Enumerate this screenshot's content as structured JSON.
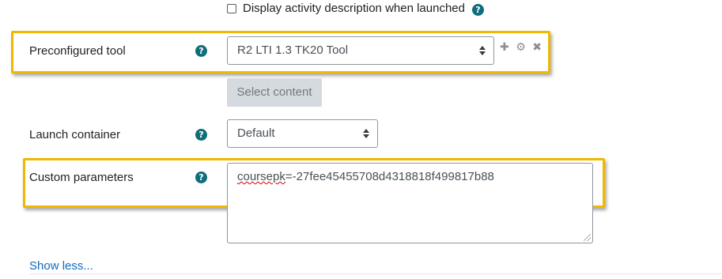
{
  "activity_description": {
    "checkbox_label": "Display activity description when launched",
    "checked": false,
    "help_glyph": "?"
  },
  "preconfigured_tool": {
    "label": "Preconfigured tool",
    "value": "R2 LTI 1.3 TK20 Tool",
    "icons": [
      "plus-icon",
      "gear-icon",
      "close-icon"
    ],
    "icon_glyphs": {
      "add": "✚",
      "settings": "⚙",
      "remove": "✖"
    }
  },
  "select_content": {
    "label": "Select content",
    "disabled": true
  },
  "launch_container": {
    "label": "Launch container",
    "value": "Default"
  },
  "custom_parameters": {
    "label": "Custom parameters",
    "value_prefix": "coursepk",
    "value_suffix": "=-27fee45455708d4318818f499817b88"
  },
  "show_less": {
    "label": "Show less..."
  },
  "colors": {
    "highlight": "#f0b800",
    "help_icon": "#0f6e7a",
    "link": "#0f6cbf"
  }
}
